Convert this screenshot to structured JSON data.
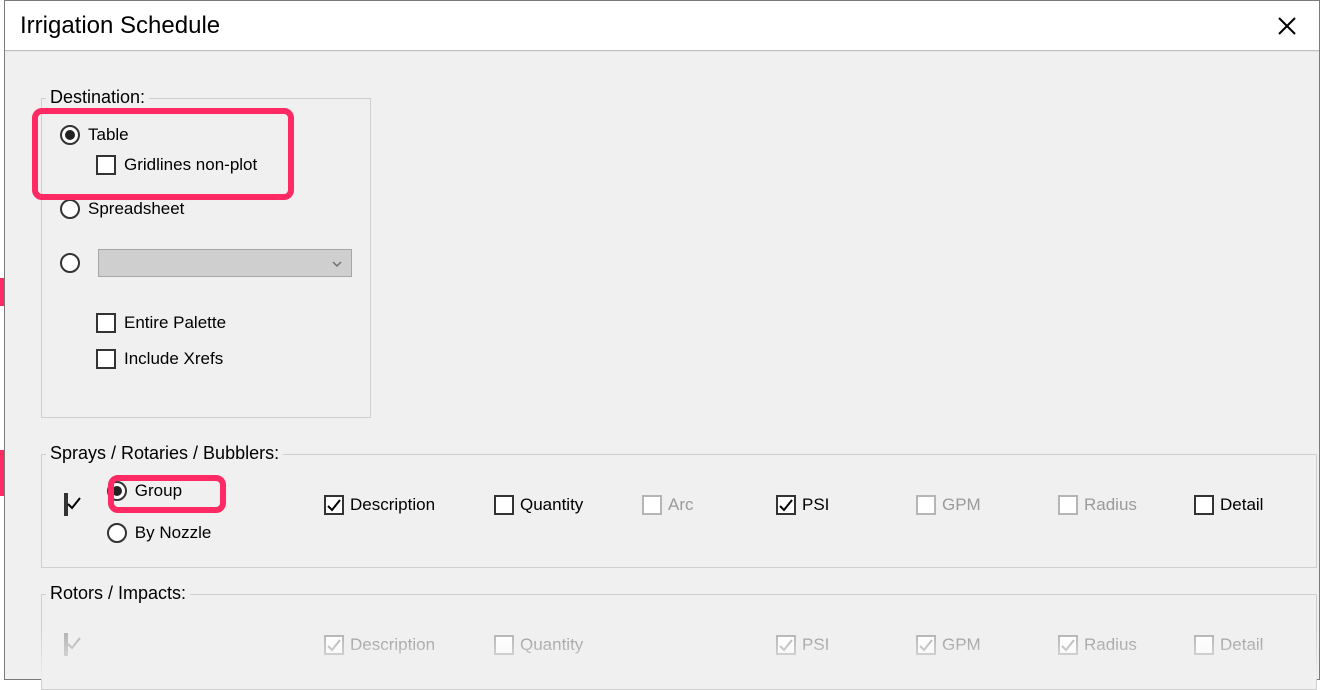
{
  "window": {
    "title": "Irrigation Schedule"
  },
  "destination": {
    "legend": "Destination:",
    "table": {
      "label": "Table",
      "selected": true
    },
    "gridlines": {
      "label": "Gridlines non-plot",
      "checked": false
    },
    "spreadsheet": {
      "label": "Spreadsheet",
      "selected": false
    },
    "dropdown": {
      "selected": false,
      "value": ""
    },
    "entire_palette": {
      "label": "Entire Palette",
      "checked": false
    },
    "include_xrefs": {
      "label": "Include Xrefs",
      "checked": false
    }
  },
  "sprays": {
    "legend": "Sprays / Rotaries / Bubblers:",
    "enabled": true,
    "group": {
      "label": "Group",
      "selected": true
    },
    "by_nozzle": {
      "label": "By Nozzle",
      "selected": false
    },
    "options": {
      "description": {
        "label": "Description",
        "checked": true,
        "enabled": true
      },
      "quantity": {
        "label": "Quantity",
        "checked": false,
        "enabled": true
      },
      "arc": {
        "label": "Arc",
        "checked": false,
        "enabled": false
      },
      "psi": {
        "label": "PSI",
        "checked": true,
        "enabled": true
      },
      "gpm": {
        "label": "GPM",
        "checked": false,
        "enabled": false
      },
      "radius": {
        "label": "Radius",
        "checked": false,
        "enabled": false
      },
      "detail": {
        "label": "Detail",
        "checked": false,
        "enabled": true
      }
    }
  },
  "rotors": {
    "legend": "Rotors / Impacts:",
    "enabled": true,
    "options": {
      "description": {
        "label": "Description",
        "checked": true,
        "enabled": false
      },
      "quantity": {
        "label": "Quantity",
        "checked": false,
        "enabled": false
      },
      "psi": {
        "label": "PSI",
        "checked": true,
        "enabled": false
      },
      "gpm": {
        "label": "GPM",
        "checked": true,
        "enabled": false
      },
      "radius": {
        "label": "Radius",
        "checked": true,
        "enabled": false
      },
      "detail": {
        "label": "Detail",
        "checked": false,
        "enabled": false
      }
    }
  }
}
